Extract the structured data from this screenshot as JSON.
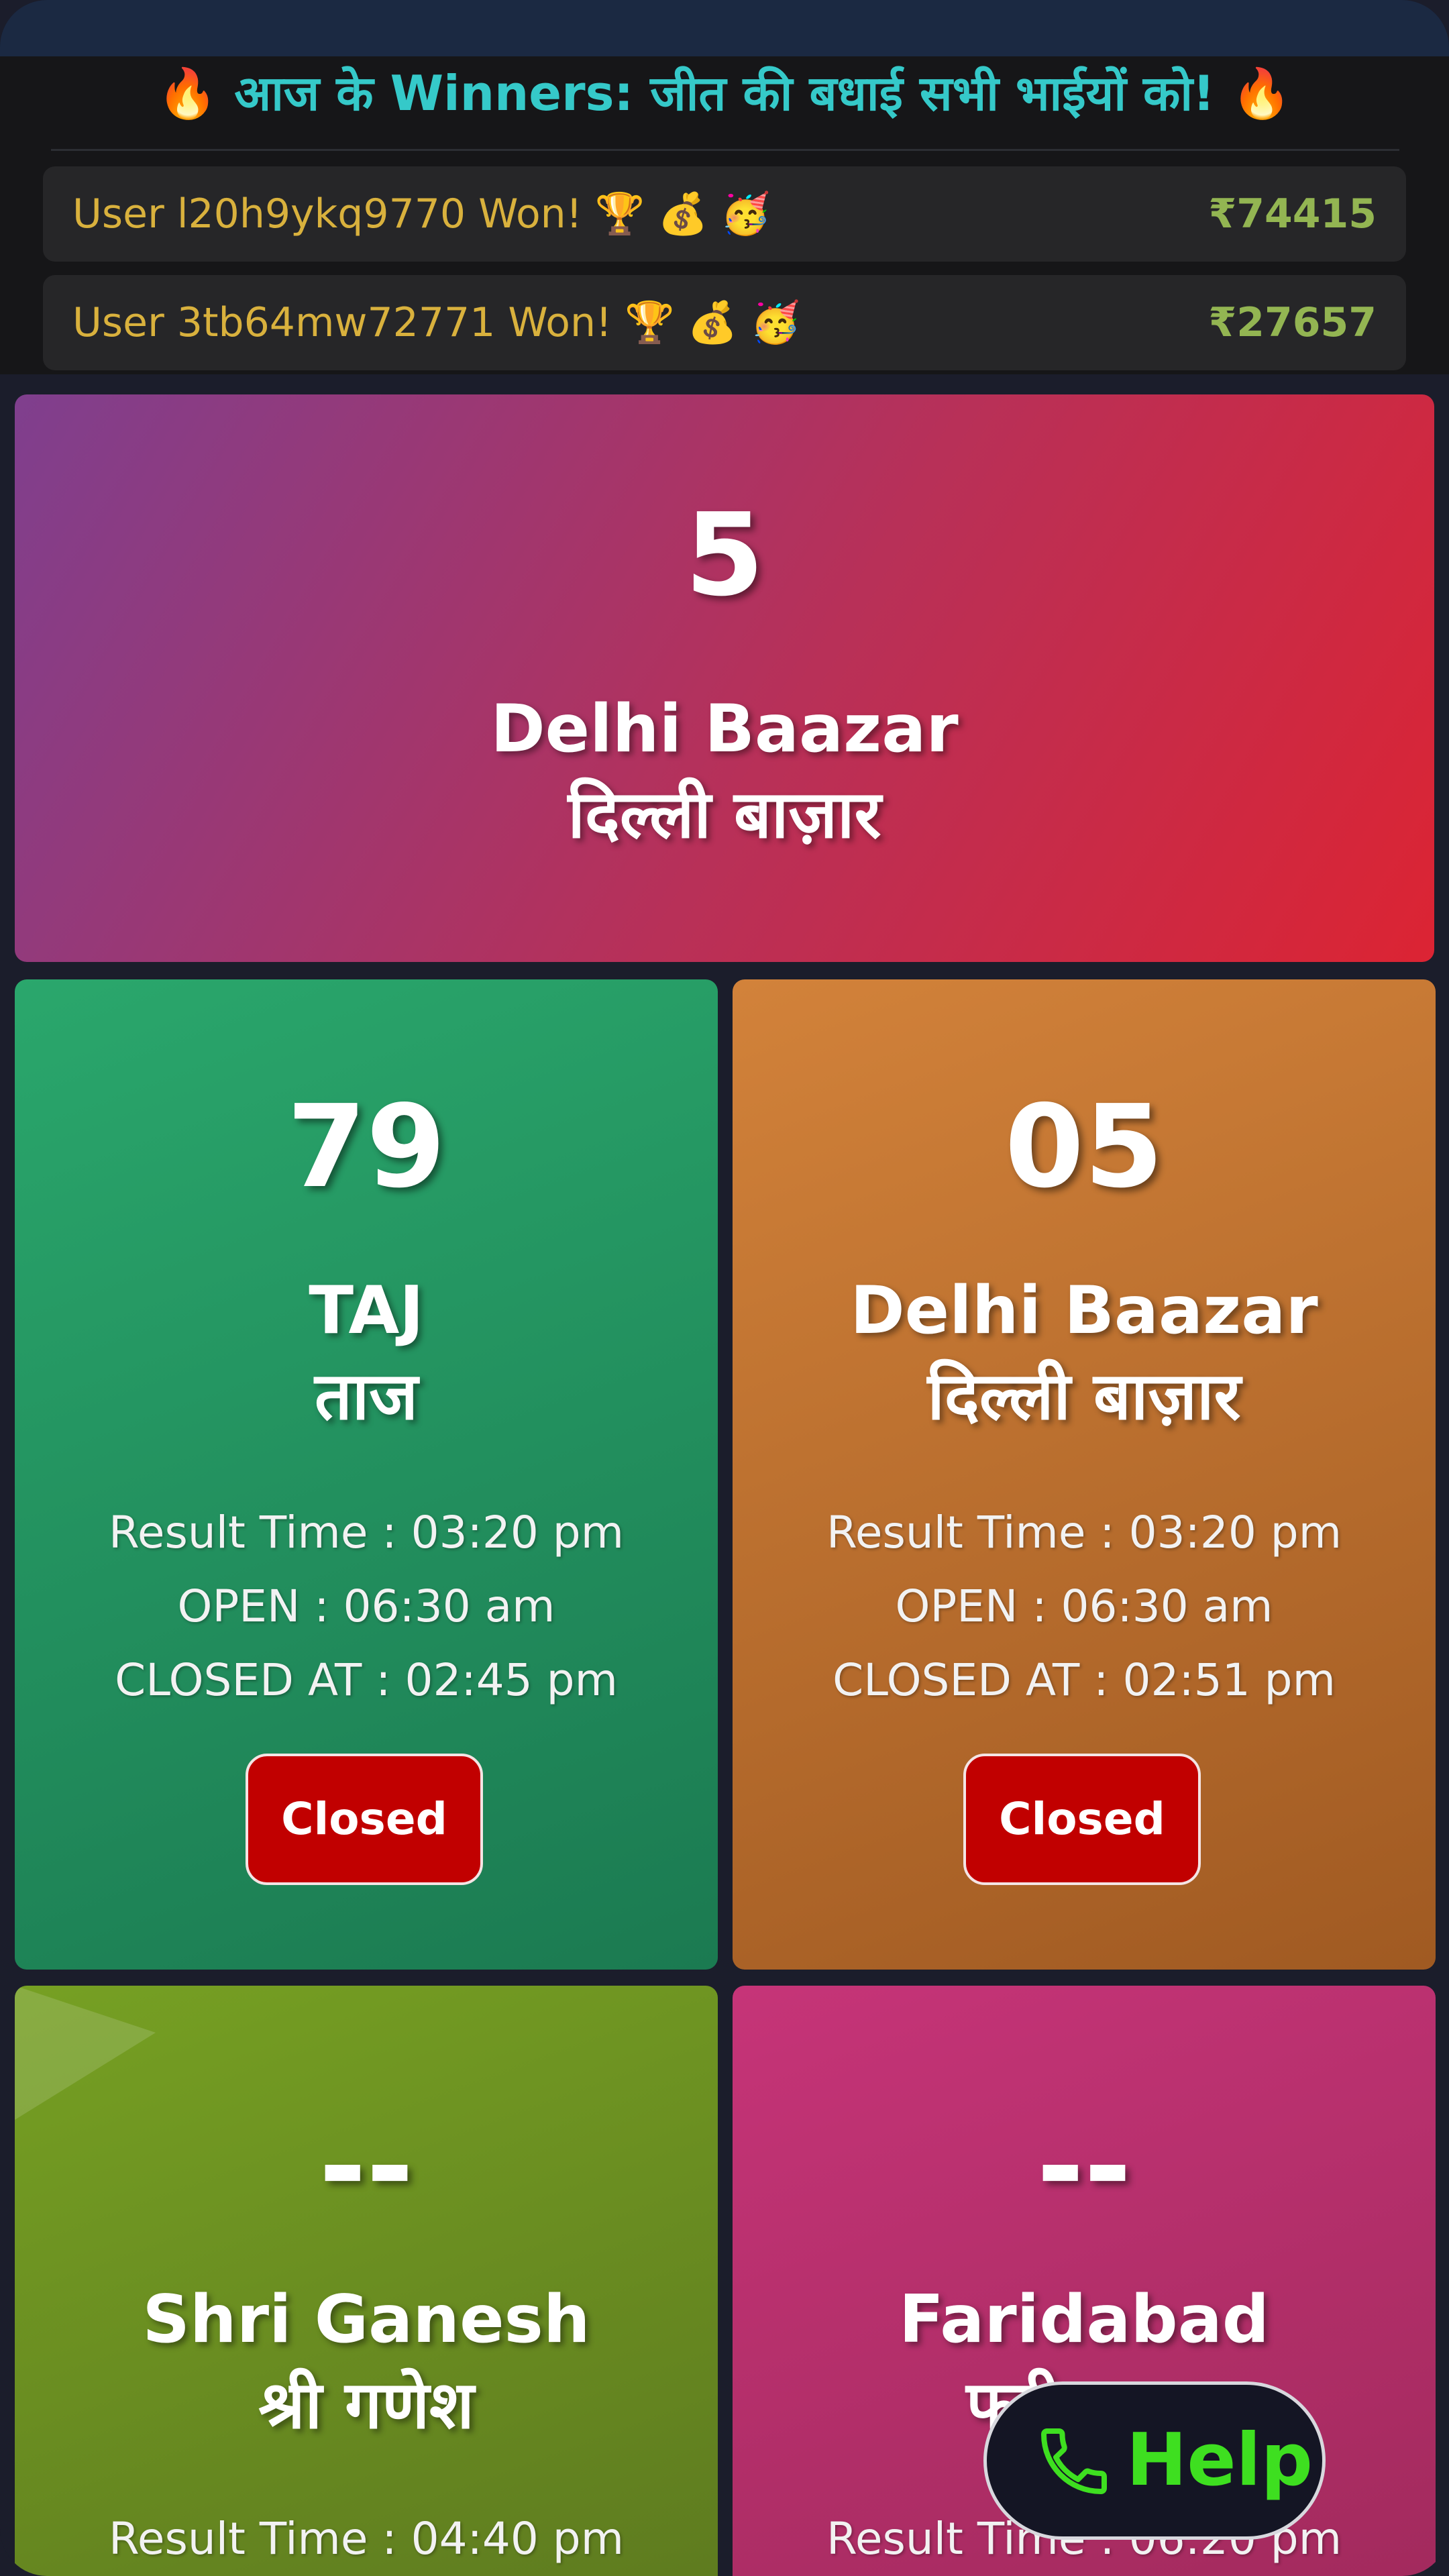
{
  "winners": {
    "title": "आज के Winners: जीत की बधाई सभी भाईयों को!",
    "fire_icon": "🔥",
    "rows": [
      {
        "text": "User l20h9ykq9770 Won! 🏆 💰 🥳",
        "amount": "₹74415"
      },
      {
        "text": "User 3tb64mw72771 Won! 🏆 💰 🥳",
        "amount": "₹27657"
      }
    ]
  },
  "featured": {
    "number": "5",
    "name_en": "Delhi Baazar",
    "name_hi": "दिल्ली बाज़ार"
  },
  "games": [
    {
      "number": "79",
      "name_en": "TAJ",
      "name_hi": "ताज",
      "result_time": "Result Time : 03:20 pm",
      "open": "OPEN : 06:30 am",
      "closed_at": "CLOSED AT : 02:45 pm",
      "status": "Closed"
    },
    {
      "number": "05",
      "name_en": "Delhi Baazar",
      "name_hi": "दिल्ली बाज़ार",
      "result_time": "Result Time : 03:20 pm",
      "open": "OPEN : 06:30 am",
      "closed_at": "CLOSED AT : 02:51 pm",
      "status": "Closed"
    },
    {
      "number": "--",
      "name_en": "Shri Ganesh",
      "name_hi": "श्री गणेश",
      "result_time": "Result Time : 04:40 pm"
    },
    {
      "number": "--",
      "name_en": "Faridabad",
      "name_hi": "फरीदाबाद",
      "result_time": "Result Time : 06:20 pm"
    }
  ],
  "help": {
    "label": "Help",
    "icon": "phone-icon",
    "color": "#3edf20"
  },
  "colors": {
    "featured": [
      "#7f3f8e",
      "#dc2433"
    ],
    "taj": [
      "#2aa76c",
      "#1b7a51"
    ],
    "delhi": [
      "#d2823a",
      "#a05a22"
    ],
    "ganesh": [
      "#76a023",
      "#5e7b1f"
    ],
    "faridabad": [
      "#c63478",
      "#a22a5d"
    ],
    "closed": "#c10000"
  }
}
